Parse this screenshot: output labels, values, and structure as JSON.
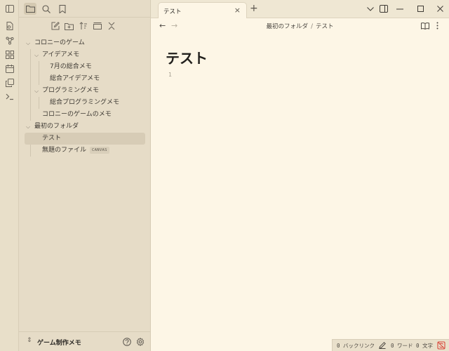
{
  "ribbon": {
    "icons": [
      "sidebar-toggle-icon",
      "graph-view-icon",
      "canvas-icon",
      "calendar-icon",
      "copy-icon",
      "terminal-icon"
    ]
  },
  "sidebar": {
    "tabs": [
      "folder-icon",
      "search-icon",
      "bookmark-icon"
    ],
    "tools": [
      "new-note-icon",
      "new-folder-icon",
      "sort-icon",
      "collapse-icon",
      "close-all-icon"
    ],
    "tree": [
      {
        "label": "コロニーのゲーム",
        "level": 0,
        "type": "folder",
        "expanded": true
      },
      {
        "label": "アイデアメモ",
        "level": 1,
        "type": "folder",
        "expanded": true
      },
      {
        "label": "7月の総合メモ",
        "level": 2,
        "type": "file"
      },
      {
        "label": "総合アイデアメモ",
        "level": 2,
        "type": "file"
      },
      {
        "label": "プログラミングメモ",
        "level": 1,
        "type": "folder",
        "expanded": true
      },
      {
        "label": "総合プログラミングメモ",
        "level": 2,
        "type": "file"
      },
      {
        "label": "コロニーのゲームのメモ",
        "level": 1,
        "type": "file"
      },
      {
        "label": "最初のフォルダ",
        "level": 0,
        "type": "folder",
        "expanded": true
      },
      {
        "label": "テスト",
        "level": 1,
        "type": "file",
        "selected": true
      },
      {
        "label": "無題のファイル",
        "level": 1,
        "type": "file",
        "badge": "CANVAS"
      }
    ],
    "vault_name": "ゲーム制作メモ"
  },
  "tabbar": {
    "tab_label": "テスト",
    "new_tab": "+"
  },
  "navbar": {
    "breadcrumb_folder": "最初のフォルダ",
    "breadcrumb_sep": "/",
    "breadcrumb_file": "テスト"
  },
  "editor": {
    "title": "テスト",
    "line_number": "1"
  },
  "statusbar": {
    "backlinks": "0 バックリンク",
    "words": "0 ワード",
    "chars": "0 文字"
  },
  "colors": {
    "background": "#fdf6e6",
    "sidebar": "#e6dcc7",
    "selected": "#d7ccb6",
    "accent_red": "#d9463b"
  }
}
